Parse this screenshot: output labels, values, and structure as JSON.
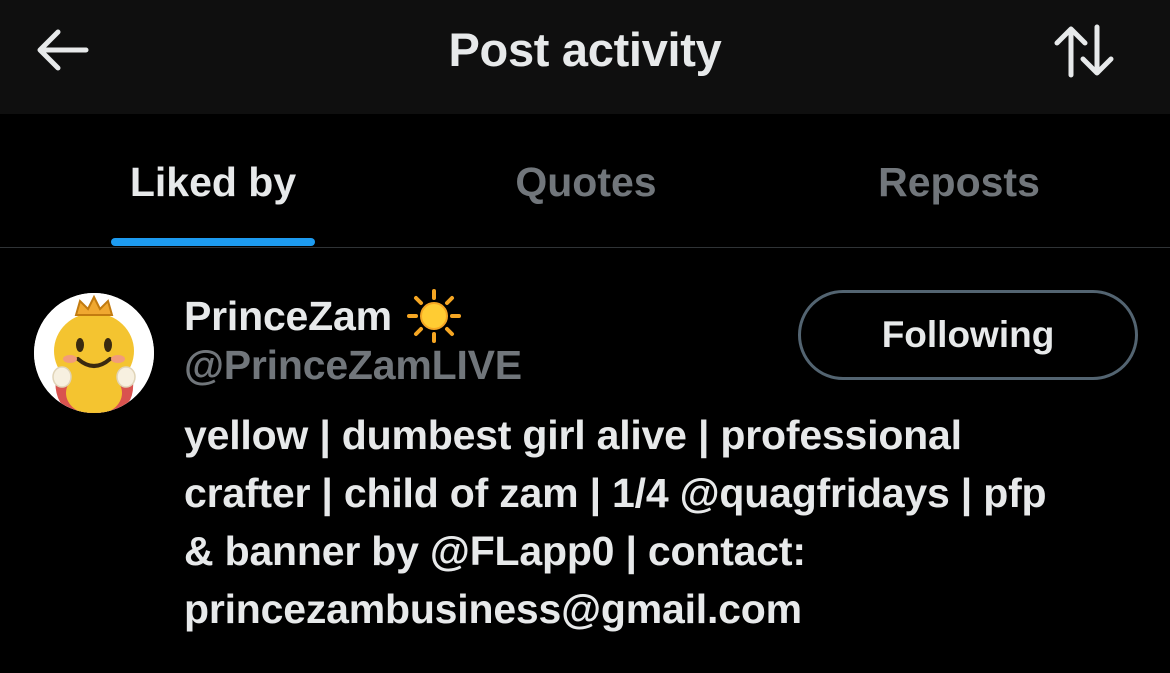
{
  "header": {
    "title": "Post activity",
    "back_icon": "arrow-left-icon",
    "sort_icon": "sort-arrows-icon"
  },
  "tabs": [
    {
      "label": "Liked by",
      "active": true
    },
    {
      "label": "Quotes",
      "active": false
    },
    {
      "label": "Reposts",
      "active": false
    }
  ],
  "user": {
    "display_name": "PrinceZam",
    "name_emoji": "sun-icon",
    "handle": "@PrinceZamLIVE",
    "follow_label": "Following",
    "bio_lines": [
      "yellow | dumbest girl alive | professional",
      "crafter | child of zam | 1/4 @quagfridays | pfp",
      "& banner by @FLapp0 | contact:",
      "princezambusiness@gmail.com"
    ]
  },
  "colors": {
    "background": "#000000",
    "header_bg": "#0f0f0f",
    "text_primary": "#e7e9ea",
    "text_secondary": "#71767b",
    "accent": "#1d9bf0",
    "divider": "#2f3336",
    "button_border": "#536471"
  }
}
